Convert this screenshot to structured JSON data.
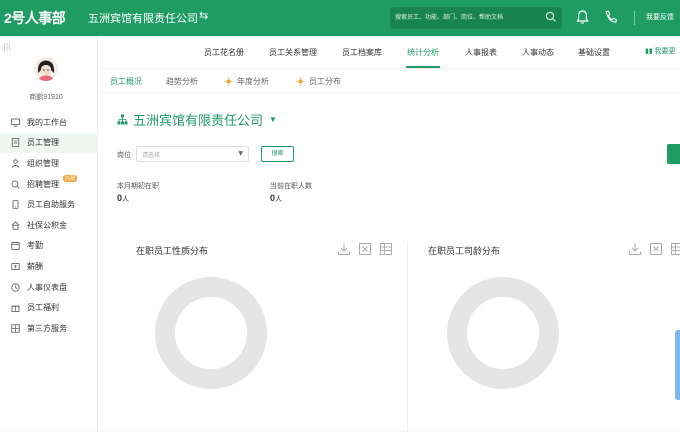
{
  "header": {
    "logo": "2号人事部",
    "company": "五洲宾馆有限责任公司",
    "search_placeholder": "搜索员工、功能、部门、岗位、帮助文档",
    "feedback": "我要反馈"
  },
  "sidebar": {
    "username": "商鹏91910",
    "items": [
      {
        "label": "我的工作台",
        "icon": "monitor-icon"
      },
      {
        "label": "员工管理",
        "icon": "document-icon",
        "active": true
      },
      {
        "label": "组织管理",
        "icon": "org-icon"
      },
      {
        "label": "招聘管理",
        "icon": "search-user-icon",
        "badge": "内测"
      },
      {
        "label": "员工自助服务",
        "icon": "phone-icon"
      },
      {
        "label": "社保公积金",
        "icon": "house-icon"
      },
      {
        "label": "考勤",
        "icon": "calendar-icon"
      },
      {
        "label": "薪酬",
        "icon": "money-icon"
      },
      {
        "label": "人事仪表盘",
        "icon": "clock-icon"
      },
      {
        "label": "员工福利",
        "icon": "gift-icon"
      },
      {
        "label": "第三方服务",
        "icon": "grid-icon"
      }
    ]
  },
  "nav": {
    "items": [
      "员工花名册",
      "员工关系管理",
      "员工档案库",
      "统计分析",
      "人事报表",
      "人事动态",
      "基础设置"
    ],
    "active": "统计分析",
    "extra": "我要更"
  },
  "subnav": {
    "items": [
      "员工概况",
      "趋势分析",
      "年度分析",
      "员工分布"
    ],
    "active": "员工概况"
  },
  "main": {
    "org_title": "五洲宾馆有限责任公司",
    "filter_label": "岗位",
    "select_placeholder": "请选择",
    "search_button": "搜索",
    "stats": [
      {
        "label": "本月期初在职",
        "value": "0",
        "unit": "人"
      },
      {
        "label": "当前在职人数",
        "value": "0",
        "unit": "人"
      }
    ],
    "cards": [
      {
        "title": "在职员工性质分布"
      },
      {
        "title": "在职员工司龄分布"
      }
    ]
  },
  "colors": {
    "accent": "#1f9c64"
  }
}
